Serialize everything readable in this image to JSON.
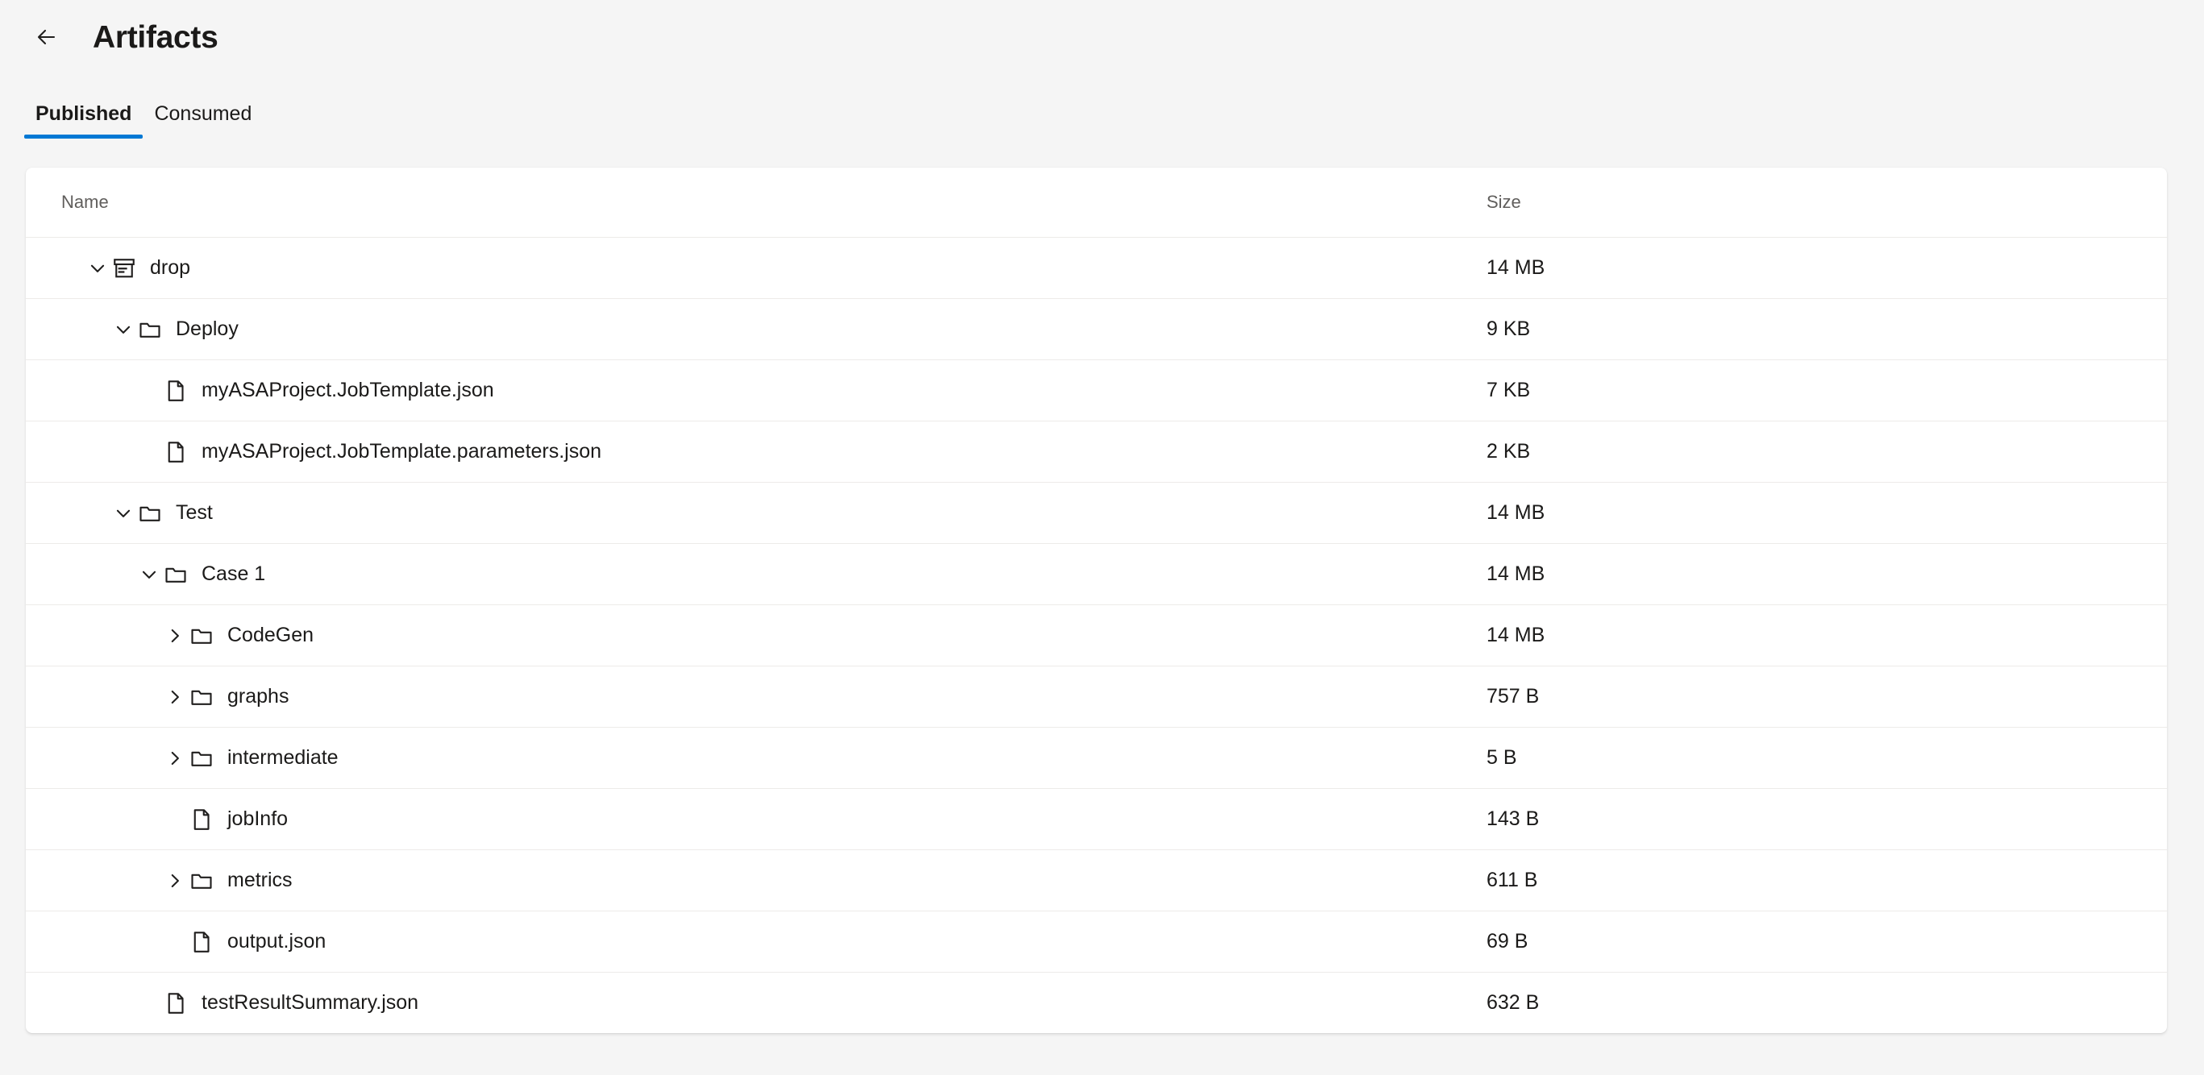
{
  "header": {
    "back_icon": "arrow-left-icon",
    "title": "Artifacts"
  },
  "tabs": [
    {
      "label": "Published",
      "active": true
    },
    {
      "label": "Consumed",
      "active": false
    }
  ],
  "table": {
    "columns": [
      {
        "key": "name",
        "label": "Name"
      },
      {
        "key": "size",
        "label": "Size"
      }
    ],
    "rows": [
      {
        "name": "drop",
        "size": "14 MB",
        "depth": 0,
        "icon": "archive-box-icon",
        "toggle": "expanded"
      },
      {
        "name": "Deploy",
        "size": "9 KB",
        "depth": 1,
        "icon": "folder-icon",
        "toggle": "expanded"
      },
      {
        "name": "myASAProject.JobTemplate.json",
        "size": "7 KB",
        "depth": 2,
        "icon": "file-icon",
        "toggle": "none"
      },
      {
        "name": "myASAProject.JobTemplate.parameters.json",
        "size": "2 KB",
        "depth": 2,
        "icon": "file-icon",
        "toggle": "none"
      },
      {
        "name": "Test",
        "size": "14 MB",
        "depth": 1,
        "icon": "folder-icon",
        "toggle": "expanded"
      },
      {
        "name": "Case 1",
        "size": "14 MB",
        "depth": 2,
        "icon": "folder-icon",
        "toggle": "expanded"
      },
      {
        "name": "CodeGen",
        "size": "14 MB",
        "depth": 3,
        "icon": "folder-icon",
        "toggle": "collapsed"
      },
      {
        "name": "graphs",
        "size": "757 B",
        "depth": 3,
        "icon": "folder-icon",
        "toggle": "collapsed"
      },
      {
        "name": "intermediate",
        "size": "5 B",
        "depth": 3,
        "icon": "folder-icon",
        "toggle": "collapsed"
      },
      {
        "name": "jobInfo",
        "size": "143 B",
        "depth": 3,
        "icon": "file-icon",
        "toggle": "none"
      },
      {
        "name": "metrics",
        "size": "611 B",
        "depth": 3,
        "icon": "folder-icon",
        "toggle": "collapsed"
      },
      {
        "name": "output.json",
        "size": "69 B",
        "depth": 3,
        "icon": "file-icon",
        "toggle": "none"
      },
      {
        "name": "testResultSummary.json",
        "size": "632 B",
        "depth": 2,
        "icon": "file-icon",
        "toggle": "none"
      }
    ]
  },
  "colors": {
    "accent": "#0078d4",
    "page_background": "#f5f5f5",
    "card_background": "#ffffff",
    "row_divider": "#edebe9",
    "text_primary": "#1b1a19",
    "text_secondary": "#605e5c"
  }
}
